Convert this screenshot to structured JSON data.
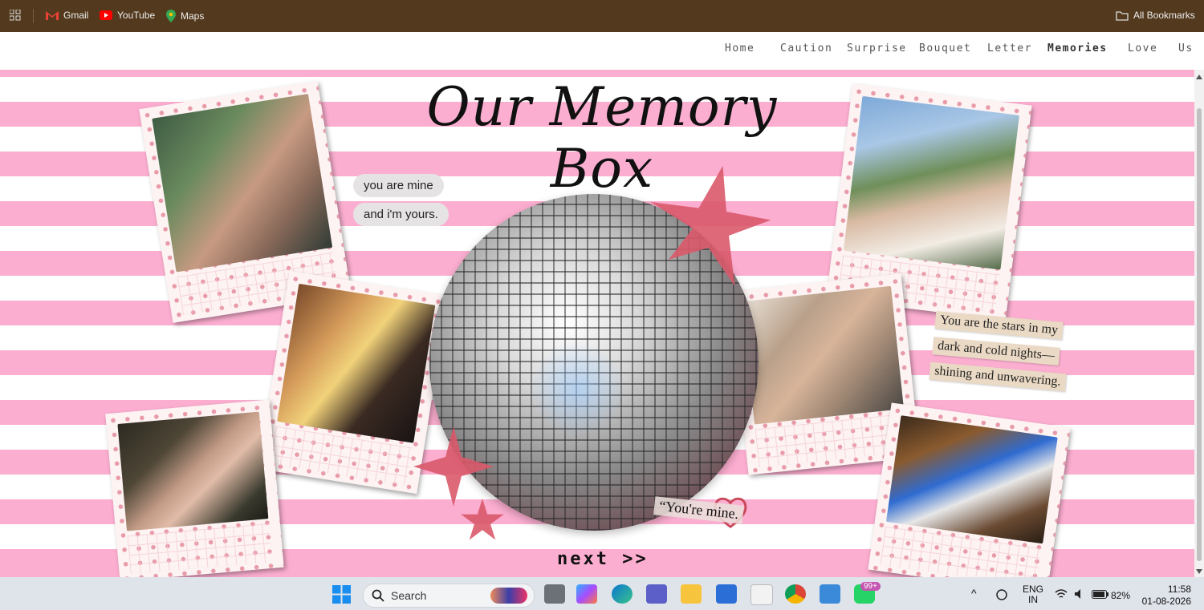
{
  "bookmarks": {
    "items": [
      {
        "label": "Gmail",
        "icon": "gmail-icon"
      },
      {
        "label": "YouTube",
        "icon": "youtube-icon"
      },
      {
        "label": "Maps",
        "icon": "maps-icon"
      }
    ],
    "all_bookmarks": "All Bookmarks"
  },
  "nav": {
    "items": [
      "Home",
      "Caution",
      "Surprise",
      "Bouquet",
      "Letter",
      "Memories",
      "Love",
      "Us"
    ],
    "active": "Memories"
  },
  "page": {
    "title": "Our Memory Box",
    "bubble1": "you are mine",
    "bubble2": "and i'm yours.",
    "paper1": "You are the stars in my",
    "paper2": "dark and cold nights—",
    "paper3": "shining and unwavering.",
    "quote": "“You're mine.",
    "next": "next >>"
  },
  "colors": {
    "stripe_pink": "#fcaed0",
    "bookmark_bar": "#53391d",
    "star_glitter": "#d9596a"
  },
  "taskbar": {
    "search_label": "Search",
    "badge": "99+",
    "lang1": "ENG",
    "lang2": "IN",
    "battery": "82%",
    "time": "11:58",
    "date": "01-08-2026"
  }
}
